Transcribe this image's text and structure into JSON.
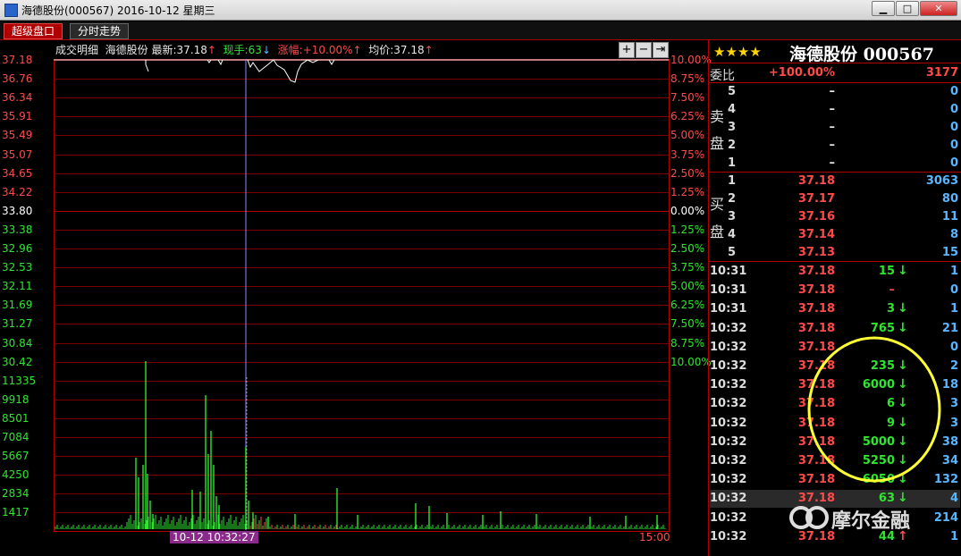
{
  "window": {
    "title": "海德股份(000567) 2016-10-12 星期三",
    "min_glyph": "▁",
    "max_glyph": "□",
    "close_glyph": "✕"
  },
  "tabs": [
    "超级盘口",
    "分时走势"
  ],
  "infobar": {
    "label": "成交明细",
    "stock": "海德股份",
    "latest_label": "最新:",
    "latest": "37.18",
    "hand_label": "现手:",
    "hand": "63",
    "chg_label": "涨幅:",
    "chg": "+10.00%",
    "avg_label": "均价:",
    "avg": "37.18"
  },
  "chart_controls": [
    "+",
    "−",
    "⇥"
  ],
  "chart_data": {
    "type": "line",
    "price_ticks": [
      "37.18",
      "36.76",
      "36.34",
      "35.91",
      "35.49",
      "35.07",
      "34.65",
      "34.22",
      "33.80",
      "33.38",
      "32.96",
      "32.53",
      "32.11",
      "31.69",
      "31.27",
      "30.84",
      "30.42"
    ],
    "pct_ticks": [
      "10.00%",
      "8.75%",
      "7.50%",
      "6.25%",
      "5.00%",
      "3.75%",
      "2.50%",
      "1.25%",
      "0.00%",
      "1.25%",
      "2.50%",
      "3.75%",
      "5.00%",
      "6.25%",
      "7.50%",
      "8.75%",
      "10.00%"
    ],
    "volume_ticks": [
      "11335",
      "9918",
      "8501",
      "7084",
      "5667",
      "4250",
      "2834",
      "1417"
    ],
    "x_label_left": "10-12 10:32:27",
    "x_label_right": "15:00",
    "price_range": [
      30.42,
      37.18
    ],
    "volume_max": 12752
  },
  "quote": {
    "stars": "★★★★",
    "name": "海德股份 000567",
    "weibi_label": "委比",
    "weibi_pct": "+100.00%",
    "weibi_val": "3177",
    "sell_label_1": "卖",
    "sell_label_2": "盘",
    "buy_label_1": "买",
    "buy_label_2": "盘",
    "sell": [
      {
        "lvl": "5",
        "price": "–",
        "vol": "0"
      },
      {
        "lvl": "4",
        "price": "–",
        "vol": "0"
      },
      {
        "lvl": "3",
        "price": "–",
        "vol": "0"
      },
      {
        "lvl": "2",
        "price": "–",
        "vol": "0"
      },
      {
        "lvl": "1",
        "price": "–",
        "vol": "0"
      }
    ],
    "buy": [
      {
        "lvl": "1",
        "price": "37.18",
        "vol": "3063"
      },
      {
        "lvl": "2",
        "price": "37.17",
        "vol": "80"
      },
      {
        "lvl": "3",
        "price": "37.16",
        "vol": "11"
      },
      {
        "lvl": "4",
        "price": "37.14",
        "vol": "8"
      },
      {
        "lvl": "5",
        "price": "37.13",
        "vol": "15"
      }
    ],
    "ticks": [
      {
        "time": "10:31",
        "price": "37.18",
        "vol": "15",
        "dir": "↓",
        "n": "1"
      },
      {
        "time": "10:31",
        "price": "37.18",
        "vol": "–",
        "dir": "",
        "n": "0"
      },
      {
        "time": "10:31",
        "price": "37.18",
        "vol": "3",
        "dir": "↓",
        "n": "1"
      },
      {
        "time": "10:32",
        "price": "37.18",
        "vol": "765",
        "dir": "↓",
        "n": "21"
      },
      {
        "time": "10:32",
        "price": "37.18",
        "vol": "",
        "dir": "",
        "n": "0"
      },
      {
        "time": "10:32",
        "price": "37.18",
        "vol": "235",
        "dir": "↓",
        "n": "2"
      },
      {
        "time": "10:32",
        "price": "37.18",
        "vol": "6000",
        "dir": "↓",
        "n": "18"
      },
      {
        "time": "10:32",
        "price": "37.18",
        "vol": "6",
        "dir": "↓",
        "n": "3"
      },
      {
        "time": "10:32",
        "price": "37.18",
        "vol": "9",
        "dir": "↓",
        "n": "3"
      },
      {
        "time": "10:32",
        "price": "37.18",
        "vol": "5000",
        "dir": "↓",
        "n": "38"
      },
      {
        "time": "10:32",
        "price": "37.18",
        "vol": "5250",
        "dir": "↓",
        "n": "34"
      },
      {
        "time": "10:32",
        "price": "37.18",
        "vol": "6050",
        "dir": "↓",
        "n": "132"
      },
      {
        "time": "10:32",
        "price": "37.18",
        "vol": "63",
        "dir": "↓",
        "n": "4"
      },
      {
        "time": "10:32",
        "price": "",
        "vol": "",
        "dir": "",
        "n": "214"
      },
      {
        "time": "10:32",
        "price": "37.18",
        "vol": "44",
        "dir": "↑",
        "n": "1"
      }
    ]
  },
  "watermark": "摩尔金融"
}
